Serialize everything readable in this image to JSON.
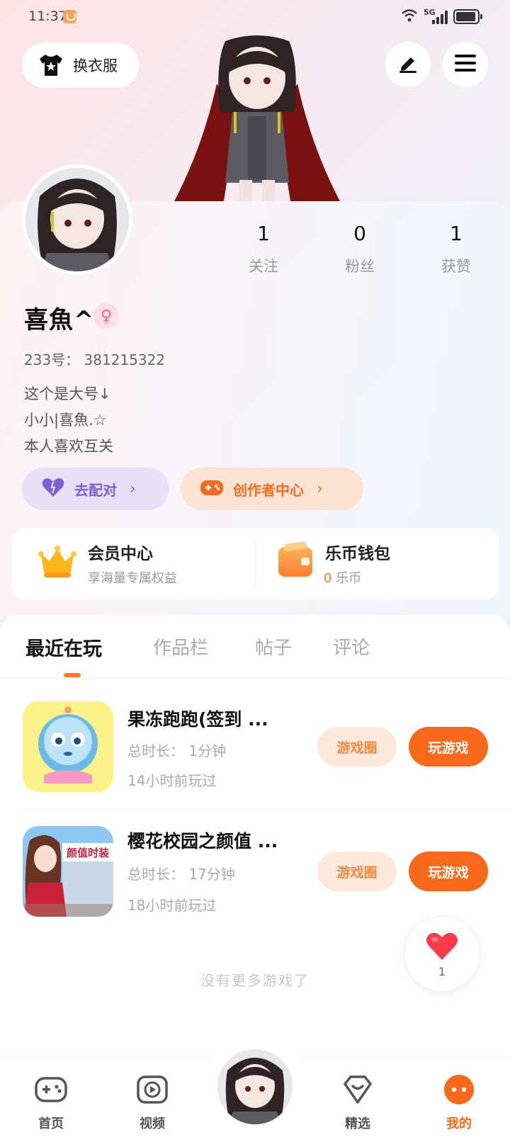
{
  "status_bar": {
    "time": "11:37",
    "network": "5G"
  },
  "header": {
    "outfit_label": "换衣服"
  },
  "stats": [
    {
      "value": "1",
      "label": "关注"
    },
    {
      "value": "0",
      "label": "粉丝"
    },
    {
      "value": "1",
      "label": "获赞"
    }
  ],
  "profile": {
    "nickname": "喜魚^",
    "gender_symbol": "♀",
    "uid": "233号： 381215322",
    "bio_lines": [
      "这个是大号↓",
      "小小|喜魚.☆",
      "本人喜欢互关"
    ],
    "match_label": "去配对",
    "creator_label": "创作者中心"
  },
  "vip": {
    "title": "会员中心",
    "subtitle": "享海量专属权益"
  },
  "wallet": {
    "title": "乐币钱包",
    "amount": "0",
    "unit": "乐币"
  },
  "tabs": [
    "最近在玩",
    "作品栏",
    "帖子",
    "评论"
  ],
  "games": [
    {
      "title": "果冻跑跑(签到 ...",
      "duration": "总时长： 1分钟",
      "last_played": "14小时前玩过",
      "circle_label": "游戏圈",
      "play_label": "玩游戏"
    },
    {
      "title": "樱花校园之颜值 ...",
      "duration": "总时长： 17分钟",
      "last_played": "18小时前玩过",
      "circle_label": "游戏圈",
      "play_label": "玩游戏",
      "icon_text": "颜值时装"
    }
  ],
  "no_more": "没有更多游戏了",
  "like_fab": {
    "count": "1"
  },
  "nav": [
    {
      "label": "首页",
      "icon": "gamepad-icon"
    },
    {
      "label": "视频",
      "icon": "video-icon"
    },
    {
      "label": "精选",
      "icon": "diamond-icon"
    },
    {
      "label": "我的",
      "icon": "me-icon",
      "active": true
    }
  ],
  "colors": {
    "accent": "#f8691c",
    "match": "#7b63d6",
    "creator": "#f36b21"
  }
}
